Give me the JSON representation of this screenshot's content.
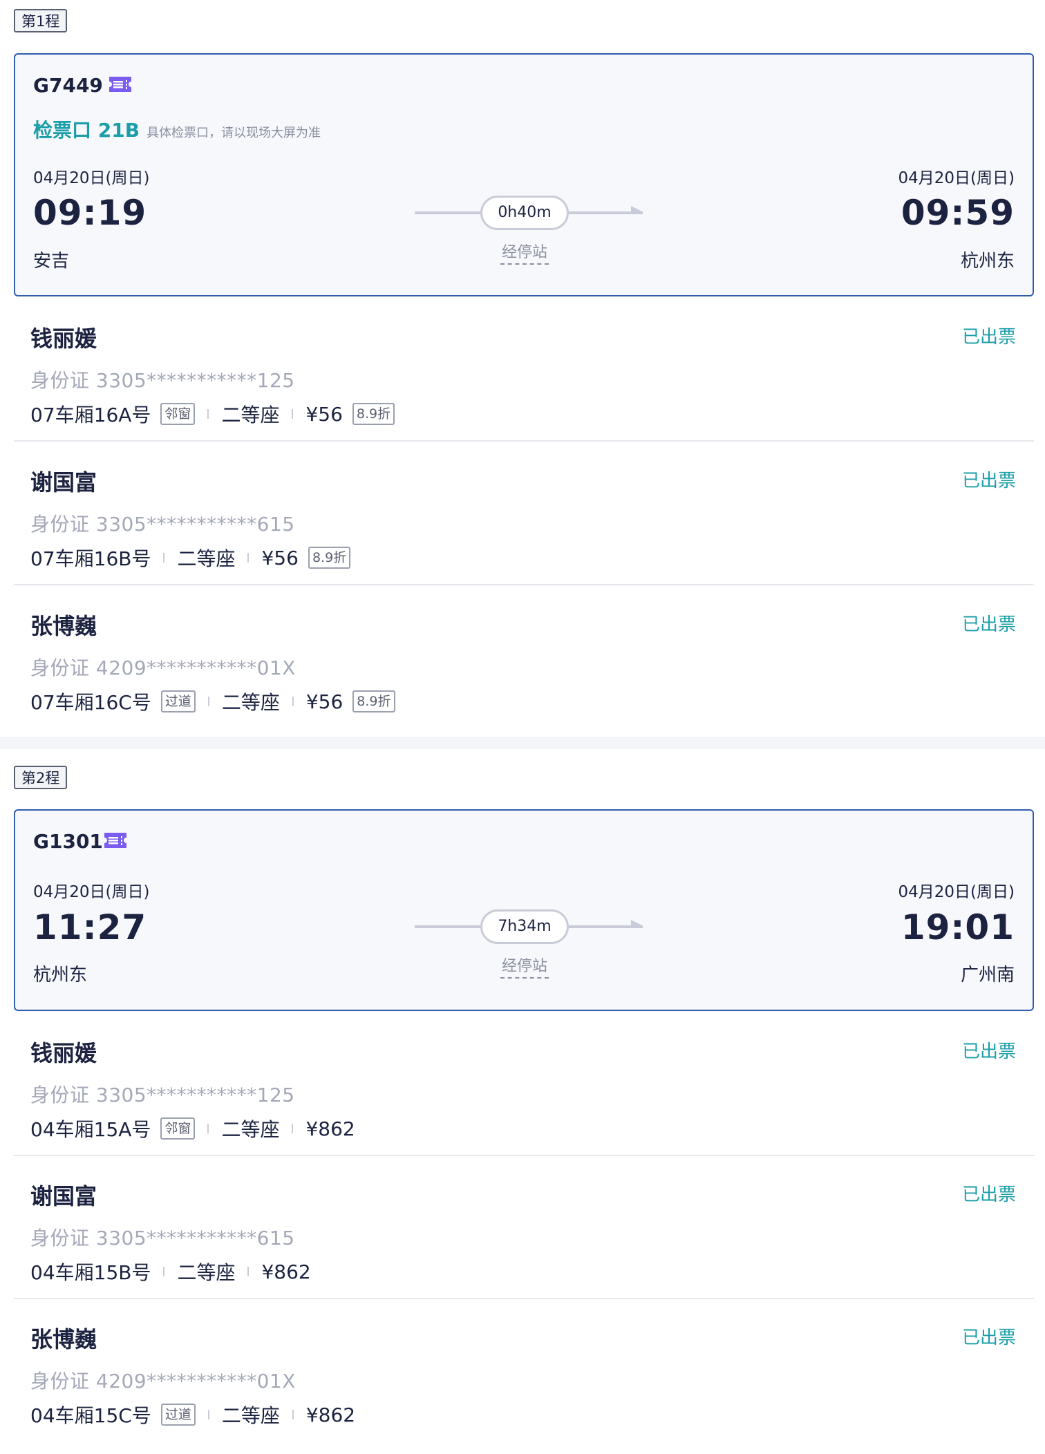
{
  "legs": [
    {
      "tag": "第1程",
      "train_no": "G7449",
      "gate": "检票口 21B",
      "gate_note": "具体检票口，请以现场大屏为准",
      "dep_date": "04月20日(周日)",
      "dep_time": "09:19",
      "dep_station": "安吉",
      "arr_date": "04月20日(周日)",
      "arr_time": "09:59",
      "arr_station": "杭州东",
      "duration": "0h40m",
      "stops_label": "经停站",
      "passengers": [
        {
          "name": "钱丽媛",
          "status": "已出票",
          "id": "身份证 3305***********125",
          "seat": "07车厢16A号",
          "pill": "邻窗",
          "class": "二等座",
          "price": "¥56",
          "discount": "8.9折"
        },
        {
          "name": "谢国富",
          "status": "已出票",
          "id": "身份证 3305***********615",
          "seat": "07车厢16B号",
          "pill": "",
          "class": "二等座",
          "price": "¥56",
          "discount": "8.9折"
        },
        {
          "name": "张博巍",
          "status": "已出票",
          "id": "身份证 4209***********01X",
          "seat": "07车厢16C号",
          "pill": "过道",
          "class": "二等座",
          "price": "¥56",
          "discount": "8.9折"
        }
      ]
    },
    {
      "tag": "第2程",
      "train_no": "G1301",
      "gate": "",
      "gate_note": "",
      "dep_date": "04月20日(周日)",
      "dep_time": "11:27",
      "dep_station": "杭州东",
      "arr_date": "04月20日(周日)",
      "arr_time": "19:01",
      "arr_station": "广州南",
      "duration": "7h34m",
      "stops_label": "经停站",
      "passengers": [
        {
          "name": "钱丽媛",
          "status": "已出票",
          "id": "身份证 3305***********125",
          "seat": "04车厢15A号",
          "pill": "邻窗",
          "class": "二等座",
          "price": "¥862",
          "discount": ""
        },
        {
          "name": "谢国富",
          "status": "已出票",
          "id": "身份证 3305***********615",
          "seat": "04车厢15B号",
          "pill": "",
          "class": "二等座",
          "price": "¥862",
          "discount": ""
        },
        {
          "name": "张博巍",
          "status": "已出票",
          "id": "身份证 4209***********01X",
          "seat": "04车厢15C号",
          "pill": "过道",
          "class": "二等座",
          "price": "¥862",
          "discount": ""
        }
      ]
    }
  ],
  "colors": {
    "accent": "#1b9ea8",
    "card_border": "#2f5dae",
    "ticket_icon": "#7b5cf0",
    "text": "#1c2340",
    "muted": "#a4a8b8"
  },
  "icons": {
    "ticket": "ticket-icon"
  }
}
